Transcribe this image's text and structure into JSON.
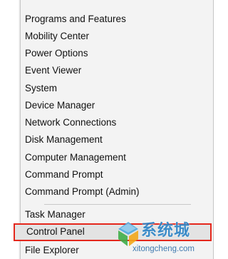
{
  "context_menu": {
    "group1": [
      {
        "label": "Programs and Features"
      },
      {
        "label": "Mobility Center"
      },
      {
        "label": "Power Options"
      },
      {
        "label": "Event Viewer"
      },
      {
        "label": "System"
      },
      {
        "label": "Device Manager"
      },
      {
        "label": "Network Connections"
      },
      {
        "label": "Disk Management"
      },
      {
        "label": "Computer Management"
      },
      {
        "label": "Command Prompt"
      },
      {
        "label": "Command Prompt (Admin)"
      }
    ],
    "group2": [
      {
        "label": "Task Manager"
      },
      {
        "label": "Control Panel",
        "highlighted": true
      },
      {
        "label": "File Explorer"
      }
    ]
  },
  "watermark": {
    "name": "系统城",
    "url": "xitongcheng.com"
  },
  "colors": {
    "highlight_border": "#e4271c",
    "watermark_blue": "#2b83c6",
    "menu_bg": "#f3f3f3"
  }
}
